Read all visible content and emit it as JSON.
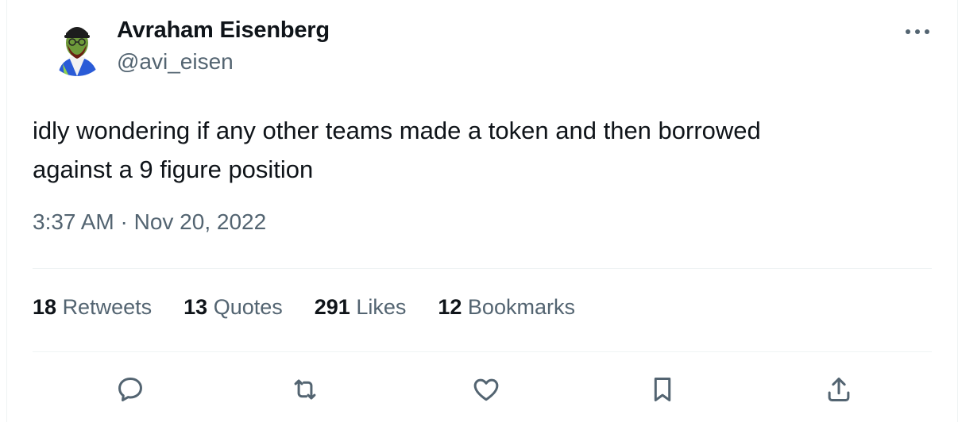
{
  "author": {
    "name": "Avraham Eisenberg",
    "handle": "@avi_eisen"
  },
  "tweet": {
    "text": "idly wondering if any other teams made a token and then borrowed\nagainst a 9 figure position",
    "timestamp": "3:37 AM · Nov 20, 2022"
  },
  "stats": [
    {
      "count": "18",
      "label": "Retweets"
    },
    {
      "count": "13",
      "label": "Quotes"
    },
    {
      "count": "291",
      "label": "Likes"
    },
    {
      "count": "12",
      "label": "Bookmarks"
    }
  ],
  "actions": [
    "reply-icon",
    "retweet-icon",
    "like-icon",
    "bookmark-icon",
    "share-icon"
  ],
  "colors": {
    "text": "#0f1419",
    "secondary": "#536471",
    "divider": "#eff3f4"
  }
}
